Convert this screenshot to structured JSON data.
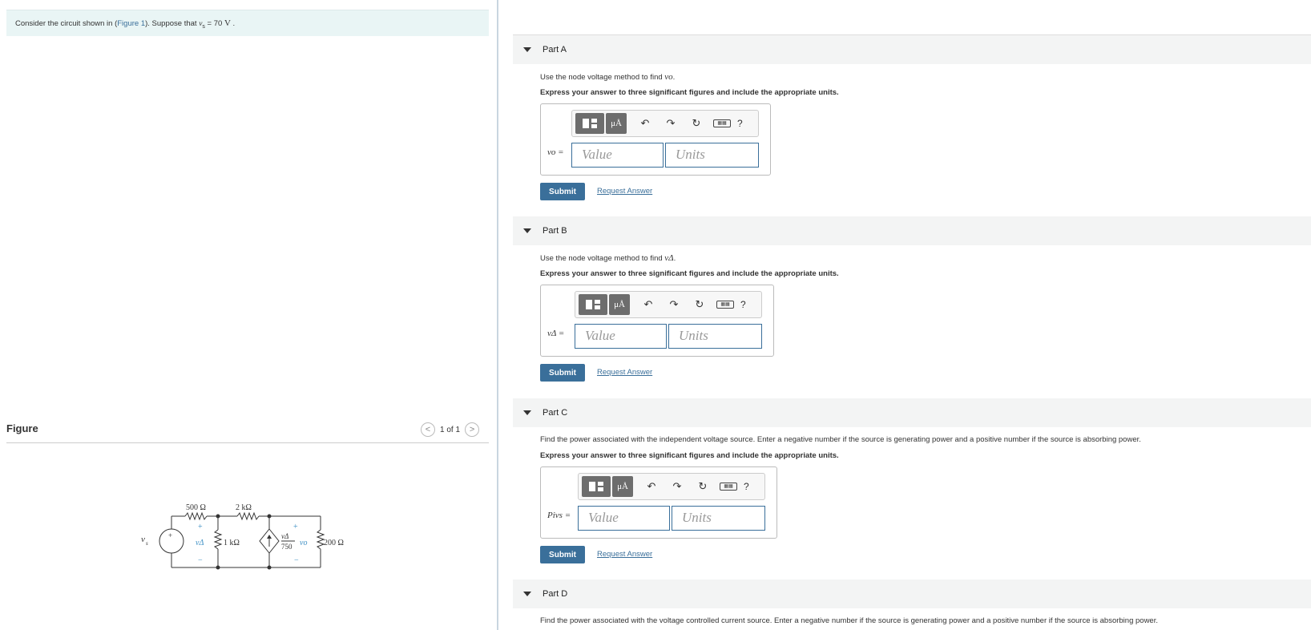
{
  "prompt": {
    "text_before": "Consider the circuit shown in (",
    "figure_link": "Figure 1",
    "text_after": "). Suppose that ",
    "var": "v",
    "var_sub": "s",
    "equals": " = 70 ",
    "unit": "V",
    "period": " ."
  },
  "figure": {
    "title": "Figure",
    "counter": "1 of 1",
    "prev_glyph": "<",
    "next_glyph": ">",
    "labels": {
      "r500": "500 Ω",
      "r2k": "2 kΩ",
      "r1k": "1 kΩ",
      "r200": "200 Ω",
      "vs": "v",
      "vs_sub": "s",
      "vdelta": "vΔ",
      "vdelta_num": "vΔ",
      "vdelta_den": "750",
      "vo": "vo",
      "plus": "+",
      "minus": "−"
    }
  },
  "parts": [
    {
      "title": "Part A",
      "question_prefix": "Use the node voltage method to find ",
      "question_var": "vo",
      "question_suffix": ".",
      "instructions": "Express your answer to three significant figures and include the appropriate units.",
      "var_label": "vo =",
      "value_placeholder": "Value",
      "units_placeholder": "Units",
      "submit": "Submit",
      "request": "Request Answer"
    },
    {
      "title": "Part B",
      "question_prefix": "Use the node voltage method to find ",
      "question_var": "vΔ",
      "question_suffix": ".",
      "instructions": "Express your answer to three significant figures and include the appropriate units.",
      "var_label": "vΔ =",
      "value_placeholder": "Value",
      "units_placeholder": "Units",
      "submit": "Submit",
      "request": "Request Answer"
    },
    {
      "title": "Part C",
      "question_prefix": "Find the power associated with the independent voltage source.  Enter a negative number if the source is generating power and a positive number if the source is absorbing power.",
      "question_var": "",
      "question_suffix": "",
      "instructions": "Express your answer to three significant figures and include the appropriate units.",
      "var_label": "Pivs =",
      "value_placeholder": "Value",
      "units_placeholder": "Units",
      "submit": "Submit",
      "request": "Request Answer"
    },
    {
      "title": "Part D",
      "question_prefix": "Find the power associated with the voltage controlled current source.  Enter a negative number if the source is generating power and a positive number if the source is absorbing power.",
      "question_var": "",
      "question_suffix": ""
    }
  ],
  "toolbar": {
    "mu_label": "μÅ",
    "undo": "↶",
    "redo": "↷",
    "reset": "↻",
    "keyboard": "▦▦",
    "help": "?"
  }
}
